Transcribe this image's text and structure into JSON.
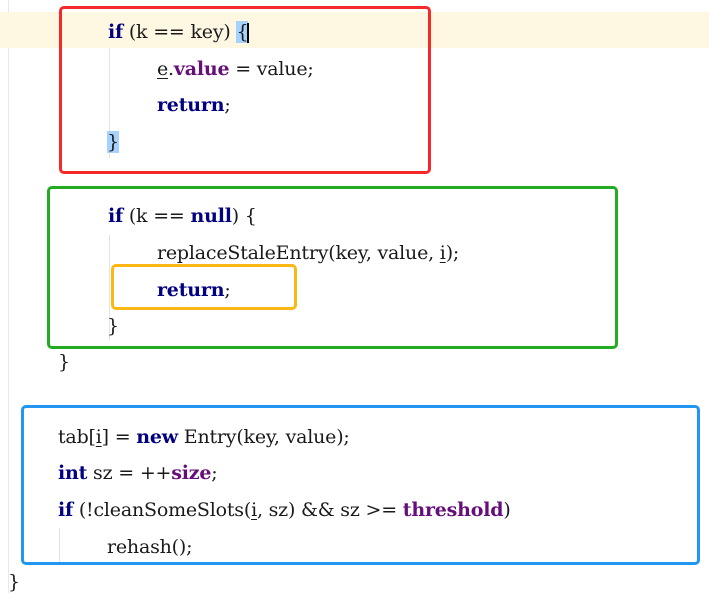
{
  "editor": {
    "lines": [
      {
        "id": "l1",
        "tokens": [
          {
            "t": "if",
            "c": "kw"
          },
          {
            "t": " (k == key) ",
            "c": "plain"
          },
          {
            "t": "{",
            "c": "brace"
          }
        ]
      },
      {
        "id": "l2",
        "tokens": [
          {
            "t": "e",
            "c": "ul"
          },
          {
            "t": ".",
            "c": "plain"
          },
          {
            "t": "value",
            "c": "field"
          },
          {
            "t": " = value;",
            "c": "plain"
          }
        ]
      },
      {
        "id": "l3",
        "tokens": [
          {
            "t": "return",
            "c": "kw"
          },
          {
            "t": ";",
            "c": "plain"
          }
        ]
      },
      {
        "id": "l4",
        "tokens": [
          {
            "t": "}",
            "c": "brace"
          }
        ]
      },
      {
        "id": "l5",
        "tokens": [
          {
            "t": "if",
            "c": "kw"
          },
          {
            "t": " (k == ",
            "c": "plain"
          },
          {
            "t": "null",
            "c": "kw"
          },
          {
            "t": ") {",
            "c": "plain"
          }
        ]
      },
      {
        "id": "l6",
        "tokens": [
          {
            "t": "replaceStaleEntry(key, value, ",
            "c": "plain"
          },
          {
            "t": "i",
            "c": "ul"
          },
          {
            "t": ");",
            "c": "plain"
          }
        ]
      },
      {
        "id": "l7",
        "tokens": [
          {
            "t": "return",
            "c": "kw"
          },
          {
            "t": ";",
            "c": "plain"
          }
        ]
      },
      {
        "id": "l8",
        "tokens": [
          {
            "t": "}",
            "c": "plain"
          }
        ]
      },
      {
        "id": "l9",
        "tokens": [
          {
            "t": "}",
            "c": "plain"
          }
        ]
      },
      {
        "id": "l10",
        "tokens": [
          {
            "t": "tab[",
            "c": "plain"
          },
          {
            "t": "i",
            "c": "ul"
          },
          {
            "t": "] = ",
            "c": "plain"
          },
          {
            "t": "new",
            "c": "kw"
          },
          {
            "t": " Entry(key, value);",
            "c": "plain"
          }
        ]
      },
      {
        "id": "l11",
        "tokens": [
          {
            "t": "int",
            "c": "kw"
          },
          {
            "t": " sz = ++",
            "c": "plain"
          },
          {
            "t": "size",
            "c": "field"
          },
          {
            "t": ";",
            "c": "plain"
          }
        ]
      },
      {
        "id": "l12",
        "tokens": [
          {
            "t": "if",
            "c": "kw"
          },
          {
            "t": " (!cleanSomeSlots(",
            "c": "plain"
          },
          {
            "t": "i",
            "c": "ul"
          },
          {
            "t": ", sz) && sz >= ",
            "c": "plain"
          },
          {
            "t": "threshold",
            "c": "field"
          },
          {
            "t": ")",
            "c": "plain"
          }
        ]
      },
      {
        "id": "l13",
        "tokens": [
          {
            "t": "rehash();",
            "c": "plain"
          }
        ]
      },
      {
        "id": "l14",
        "tokens": [
          {
            "t": "}",
            "c": "plain"
          }
        ]
      }
    ]
  },
  "annotations": {
    "red": "#f42a2a",
    "green": "#23ac23",
    "orange": "#fbb713",
    "blue": "#2196f3"
  },
  "colors": {
    "keyword": "#000080",
    "field": "#660e7a",
    "caret_line": "#fef8e3",
    "brace_match": "#a6d2ff"
  }
}
